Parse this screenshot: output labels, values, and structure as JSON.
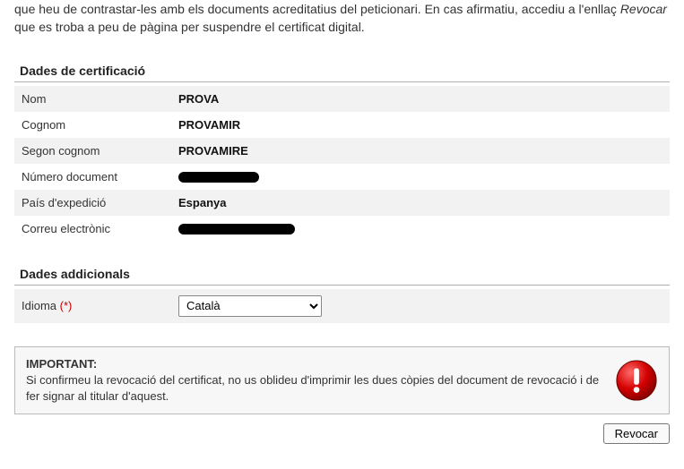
{
  "intro": {
    "line1_prefix": "que heu de contrastar-les amb els documents acreditatius del peticionari. En cas afirmatiu, accediu a l'enllaç ",
    "line1_em": "Revocar",
    "line1_suffix": " que es troba a peu de pàgina per suspendre el certificat digital."
  },
  "sections": {
    "cert_title": "Dades de certificació",
    "additional_title": "Dades addicionals"
  },
  "cert_rows": {
    "nom": {
      "label": "Nom",
      "value": "PROVA"
    },
    "cognom": {
      "label": "Cognom",
      "value": "PROVAMIR"
    },
    "segon": {
      "label": "Segon cognom",
      "value": "PROVAMIRE"
    },
    "numdoc": {
      "label": "Número document",
      "redacted": true
    },
    "pais": {
      "label": "País d'expedició",
      "value": "Espanya"
    },
    "correu": {
      "label": "Correu electrònic",
      "redacted": true
    }
  },
  "form": {
    "idioma_label": "Idioma ",
    "idioma_req": "(*)",
    "idioma_value": "Català"
  },
  "important": {
    "title": "IMPORTANT:",
    "body": "Si confirmeu la revocació del certificat, no us oblideu d'imprimir les dues còpies del document de revocació i de fer signar al titular d'aquest."
  },
  "buttons": {
    "revocar": "Revocar"
  }
}
